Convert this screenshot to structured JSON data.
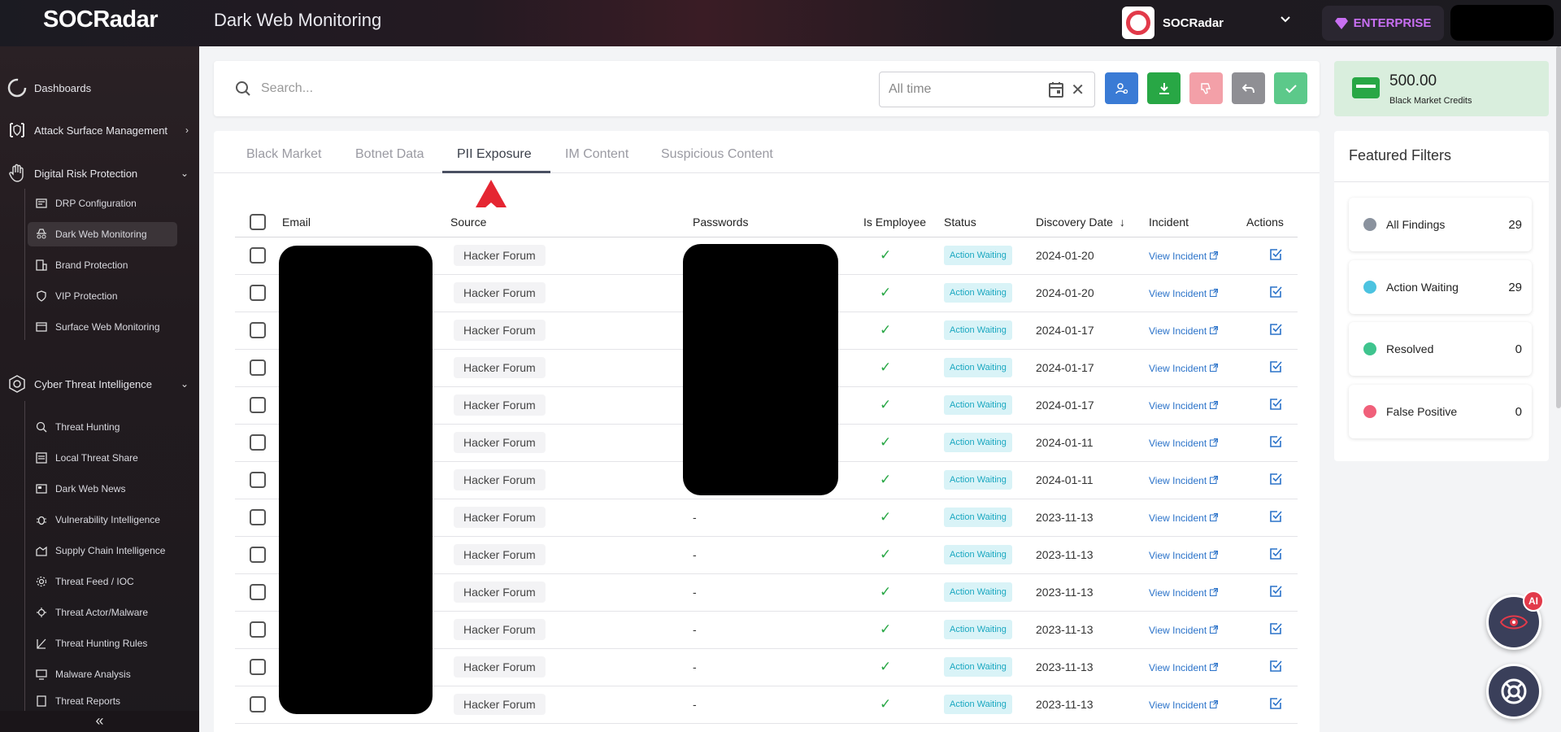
{
  "header": {
    "logo": "SOCRadar",
    "page_title": "Dark Web Monitoring",
    "org_name": "SOCRadar",
    "plan_label": "ENTERPRISE"
  },
  "sidebar": {
    "items": [
      {
        "label": "Dashboards",
        "icon": "dashboard-icon"
      },
      {
        "label": "Attack Surface Management",
        "icon": "asm-icon"
      },
      {
        "label": "Digital Risk Protection",
        "icon": "hand-icon"
      },
      {
        "label": "Cyber Threat Intelligence",
        "icon": "cti-icon"
      }
    ],
    "drp_sub": [
      {
        "label": "DRP Configuration"
      },
      {
        "label": "Dark Web Monitoring"
      },
      {
        "label": "Brand Protection"
      },
      {
        "label": "VIP Protection"
      },
      {
        "label": "Surface Web Monitoring"
      }
    ],
    "cti_sub": [
      {
        "label": "Threat Hunting"
      },
      {
        "label": "Local Threat Share"
      },
      {
        "label": "Dark Web News"
      },
      {
        "label": "Vulnerability Intelligence"
      },
      {
        "label": "Supply Chain Intelligence"
      },
      {
        "label": "Threat Feed / IOC"
      },
      {
        "label": "Threat Actor/Malware"
      },
      {
        "label": "Threat Hunting Rules"
      },
      {
        "label": "Malware Analysis"
      },
      {
        "label": "Threat Reports"
      }
    ],
    "collapse": "«"
  },
  "search": {
    "placeholder": "Search...",
    "time_value": "All time"
  },
  "credits": {
    "amount": "500.00",
    "label": "Black Market Credits"
  },
  "tabs": [
    {
      "label": "Black Market"
    },
    {
      "label": "Botnet Data"
    },
    {
      "label": "PII Exposure"
    },
    {
      "label": "IM Content"
    },
    {
      "label": "Suspicious Content"
    }
  ],
  "table": {
    "headers": {
      "email": "Email",
      "source": "Source",
      "passwords": "Passwords",
      "is_employee": "Is Employee",
      "status": "Status",
      "discovery_date": "Discovery Date",
      "incident": "Incident",
      "actions": "Actions"
    },
    "rows": [
      {
        "source": "Hacker Forum",
        "password": "",
        "status": "Action Waiting",
        "date": "2024-01-20",
        "incident": "View Incident"
      },
      {
        "source": "Hacker Forum",
        "password": "",
        "status": "Action Waiting",
        "date": "2024-01-20",
        "incident": "View Incident"
      },
      {
        "source": "Hacker Forum",
        "password": "",
        "status": "Action Waiting",
        "date": "2024-01-17",
        "incident": "View Incident"
      },
      {
        "source": "Hacker Forum",
        "password": "",
        "status": "Action Waiting",
        "date": "2024-01-17",
        "incident": "View Incident"
      },
      {
        "source": "Hacker Forum",
        "password": "",
        "status": "Action Waiting",
        "date": "2024-01-17",
        "incident": "View Incident"
      },
      {
        "source": "Hacker Forum",
        "password": "",
        "status": "Action Waiting",
        "date": "2024-01-11",
        "incident": "View Incident"
      },
      {
        "source": "Hacker Forum",
        "password": "",
        "status": "Action Waiting",
        "date": "2024-01-11",
        "incident": "View Incident"
      },
      {
        "source": "Hacker Forum",
        "password": "-",
        "status": "Action Waiting",
        "date": "2023-11-13",
        "incident": "View Incident"
      },
      {
        "source": "Hacker Forum",
        "password": "-",
        "status": "Action Waiting",
        "date": "2023-11-13",
        "incident": "View Incident"
      },
      {
        "source": "Hacker Forum",
        "password": "-",
        "status": "Action Waiting",
        "date": "2023-11-13",
        "incident": "View Incident"
      },
      {
        "source": "Hacker Forum",
        "password": "-",
        "status": "Action Waiting",
        "date": "2023-11-13",
        "incident": "View Incident"
      },
      {
        "source": "Hacker Forum",
        "password": "-",
        "status": "Action Waiting",
        "date": "2023-11-13",
        "incident": "View Incident"
      },
      {
        "source": "Hacker Forum",
        "password": "-",
        "status": "Action Waiting",
        "date": "2023-11-13",
        "incident": "View Incident"
      }
    ]
  },
  "featured_filters": {
    "title": "Featured Filters",
    "items": [
      {
        "label": "All Findings",
        "count": "29",
        "color": "#8a929e"
      },
      {
        "label": "Action Waiting",
        "count": "29",
        "color": "#4cc3e0"
      },
      {
        "label": "Resolved",
        "count": "0",
        "color": "#3fc48e"
      },
      {
        "label": "False Positive",
        "count": "0",
        "color": "#f0607a"
      }
    ]
  },
  "ai_badge": "AI",
  "colors": {
    "accent_blue": "#3a7bd5",
    "download_green": "#28a745",
    "dislike_pink": "#f3a0a8",
    "undo_gray": "#8f8f94",
    "approve_green": "#5cc98a",
    "enterprise_purple": "#c86ff2"
  }
}
